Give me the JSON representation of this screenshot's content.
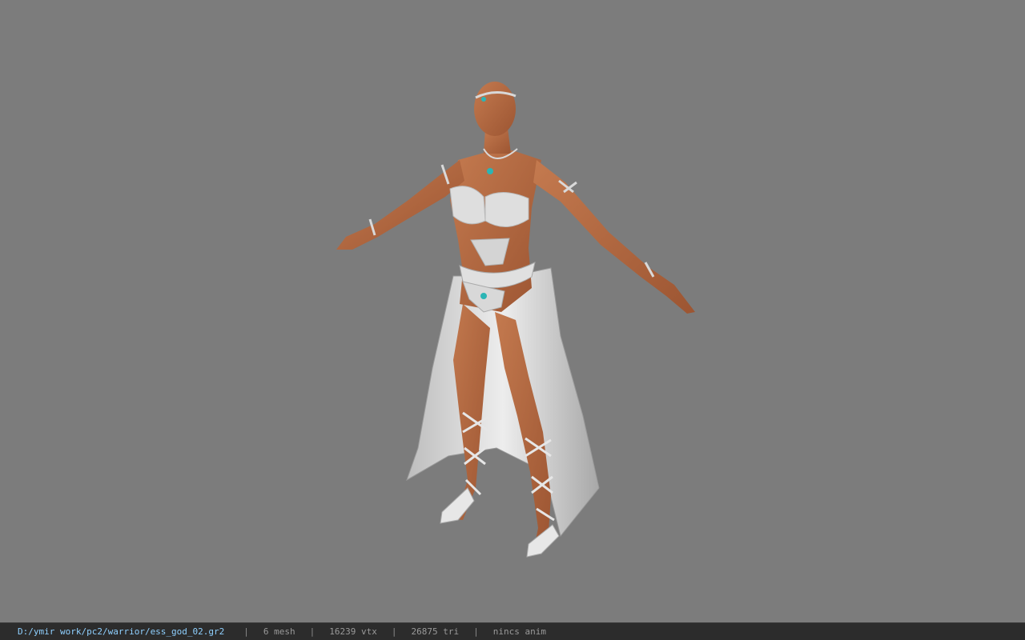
{
  "viewer": {
    "background_color": "#7c7c7c",
    "model": {
      "icon": "character-model",
      "skin_color": "#b66a43",
      "outfit_color": "#d9d9d9",
      "jewel_color": "#2bb5b5"
    }
  },
  "status_bar": {
    "file_path": "D:/ymir work/pc2/warrior/ess_god_02.gr2",
    "separator": "|",
    "mesh_count": "6 mesh",
    "vertex_count": "16239 vtx",
    "triangle_count": "26875 tri",
    "animation": "nincs anim",
    "path_color": "#8fd0ff"
  }
}
